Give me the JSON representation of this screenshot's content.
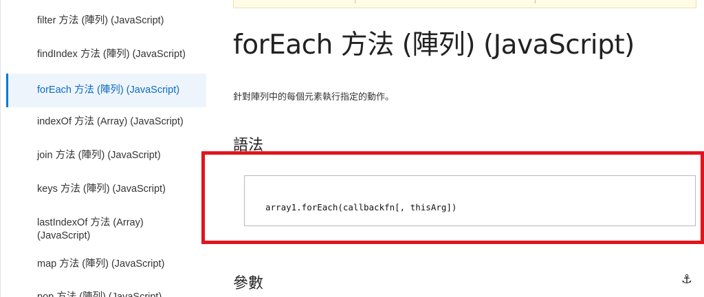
{
  "sidebar": {
    "items": [
      {
        "label": "filter 方法 (陣列) (JavaScript)",
        "active": false
      },
      {
        "label": "findIndex 方法 (陣列) (JavaScript)",
        "active": false
      },
      {
        "label": "forEach 方法 (陣列) (JavaScript)",
        "active": true
      },
      {
        "label": "indexOf 方法 (Array) (JavaScript)",
        "active": false
      },
      {
        "label": "join 方法 (陣列) (JavaScript)",
        "active": false
      },
      {
        "label": "keys 方法 (陣列) (JavaScript)",
        "active": false
      },
      {
        "label": "lastIndexOf 方法 (Array) (JavaScript)",
        "active": false
      },
      {
        "label": "map 方法 (陣列) (JavaScript)",
        "active": false
      },
      {
        "label": "pop 方法 (陣列) (JavaScript)",
        "active": false
      }
    ]
  },
  "main": {
    "title": "forEach 方法 (陣列) (JavaScript)",
    "summary": "針對陣列中的每個元素執行指定的動作。",
    "syntax_heading": "語法",
    "syntax_code": "array1.forEach(callbackfn[, thisArg])",
    "params_heading": "參數"
  },
  "icons": {
    "anchor": "anchor-icon"
  },
  "colors": {
    "accent": "#0078d4",
    "highlight_border": "#e0151d"
  }
}
